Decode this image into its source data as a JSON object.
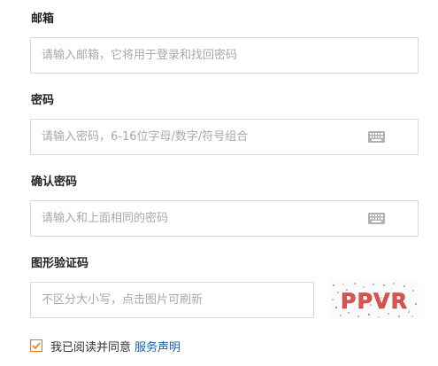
{
  "email": {
    "label": "邮箱",
    "placeholder": "请输入邮箱，它将用于登录和找回密码"
  },
  "password": {
    "label": "密码",
    "placeholder": "请输入密码，6-16位字母/数字/符号组合",
    "icon": "keyboard-icon"
  },
  "confirm_password": {
    "label": "确认密码",
    "placeholder": "请输入和上面相同的密码",
    "icon": "keyboard-icon"
  },
  "captcha": {
    "label": "图形验证码",
    "placeholder": "不区分大小写，点击图片可刷新",
    "image_text": "PPVR"
  },
  "agreement": {
    "checked": true,
    "text": "我已阅读并同意",
    "link": "服务声明"
  },
  "colors": {
    "accent": "#e8731f",
    "link": "#1f5fa8",
    "captcha_text": "#d9534f",
    "icon": "#b0b0b0"
  }
}
